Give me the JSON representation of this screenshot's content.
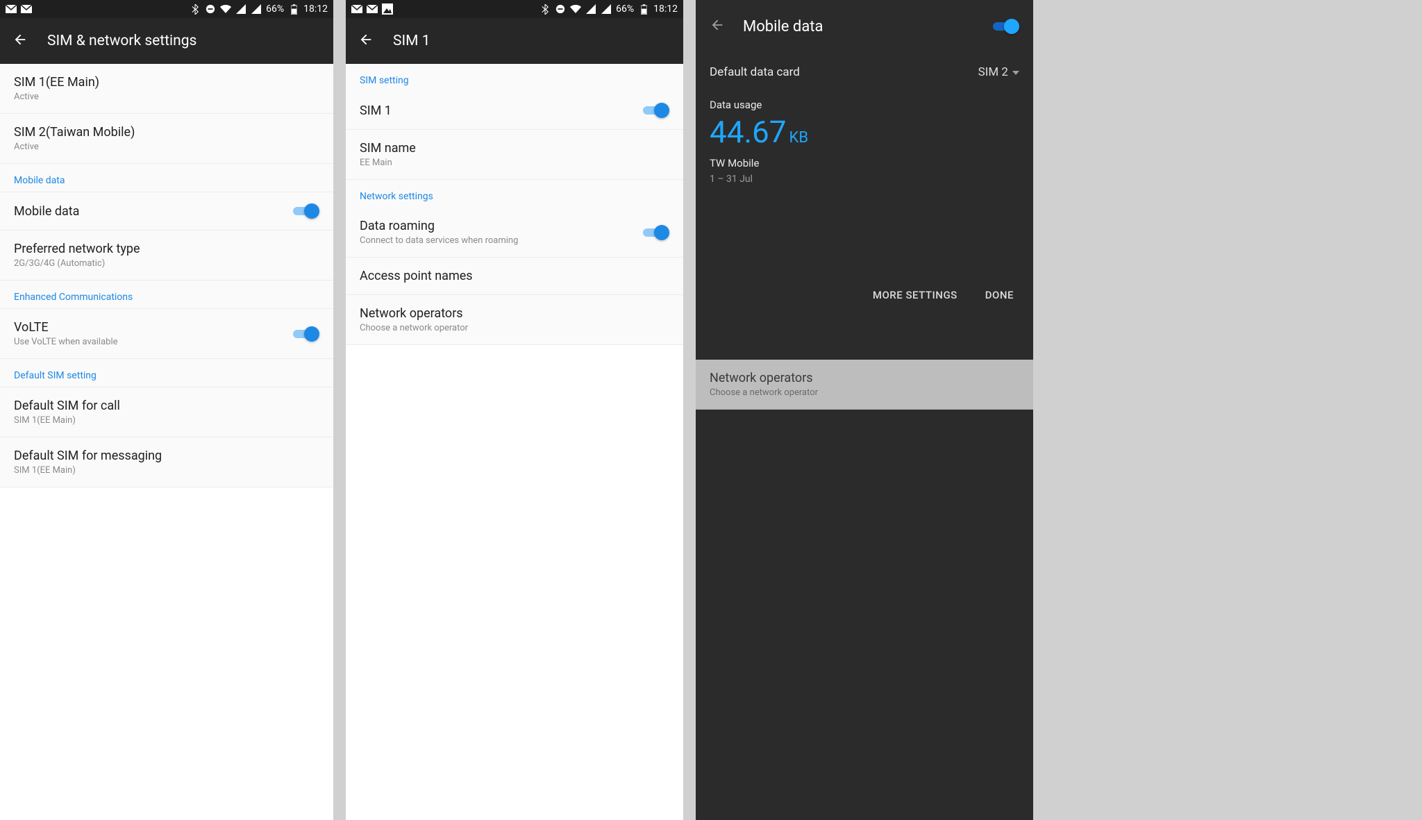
{
  "statusbar": {
    "battery": "66%",
    "time": "18:12"
  },
  "screen1": {
    "title": "SIM & network settings",
    "sim1": {
      "title": "SIM 1(EE Main)",
      "sub": "Active"
    },
    "sim2": {
      "title": "SIM 2(Taiwan Mobile)",
      "sub": "Active"
    },
    "sec_mobile": "Mobile data",
    "mobile_data": {
      "title": "Mobile data"
    },
    "pref_net": {
      "title": "Preferred network type",
      "sub": "2G/3G/4G (Automatic)"
    },
    "sec_enhanced": "Enhanced Communications",
    "volte": {
      "title": "VoLTE",
      "sub": "Use VoLTE when available"
    },
    "sec_default": "Default SIM setting",
    "def_call": {
      "title": "Default SIM for call",
      "sub": "SIM 1(EE Main)"
    },
    "def_msg": {
      "title": "Default SIM for messaging",
      "sub": "SIM 1(EE Main)"
    }
  },
  "screen2": {
    "title": "SIM 1",
    "sec_sim": "SIM setting",
    "sim_toggle": {
      "title": "SIM 1"
    },
    "sim_name": {
      "title": "SIM name",
      "sub": "EE Main"
    },
    "sec_net": "Network settings",
    "roaming": {
      "title": "Data roaming",
      "sub": "Connect to data services when roaming"
    },
    "apn": {
      "title": "Access point names"
    },
    "netops": {
      "title": "Network operators",
      "sub": "Choose a network operator"
    }
  },
  "screen3": {
    "title": "Mobile data",
    "default_card": {
      "label": "Default data card",
      "value": "SIM 2"
    },
    "usage": {
      "label": "Data usage",
      "value": "44.67",
      "unit": "KB",
      "carrier": "TW Mobile",
      "range": "1 – 31 Jul"
    },
    "actions": {
      "more": "MORE SETTINGS",
      "done": "DONE"
    },
    "bg_netops": {
      "title": "Network operators",
      "sub": "Choose a network operator"
    }
  }
}
